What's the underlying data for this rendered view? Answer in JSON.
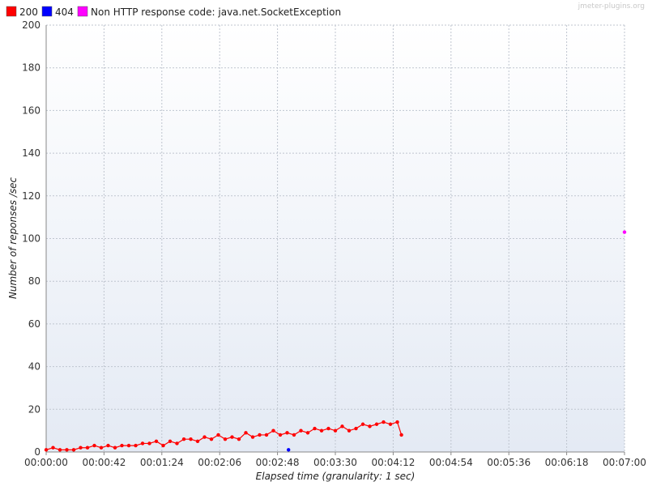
{
  "watermark": "jmeter-plugins.org",
  "colors": {
    "plot_top": "#ffffff",
    "plot_bottom": "#e4eaf4",
    "grid": "#bfc5cf",
    "axis": "#888888"
  },
  "chart_data": {
    "type": "line",
    "title": "",
    "xlabel": "Elapsed time (granularity: 1 sec)",
    "ylabel": "Number of reponses /sec",
    "xlim": [
      0,
      420
    ],
    "ylim": [
      0,
      200
    ],
    "x_ticks": [
      0,
      42,
      84,
      126,
      168,
      210,
      252,
      294,
      336,
      378,
      420
    ],
    "x_tick_labels": [
      "00:00:00",
      "00:00:42",
      "00:01:24",
      "00:02:06",
      "00:02:48",
      "00:03:30",
      "00:04:12",
      "00:04:54",
      "00:05:36",
      "00:06:18",
      "00:07:00"
    ],
    "y_ticks": [
      0,
      20,
      40,
      60,
      80,
      100,
      120,
      140,
      160,
      180,
      200
    ],
    "y_tick_labels": [
      "0",
      "20",
      "40",
      "60",
      "80",
      "100",
      "120",
      "140",
      "160",
      "180",
      "200"
    ],
    "grid": true,
    "legend_position": "top-left",
    "series": [
      {
        "name": "200",
        "color": "#ff0000",
        "x": [
          0,
          5,
          10,
          15,
          20,
          25,
          30,
          35,
          40,
          45,
          50,
          55,
          60,
          65,
          70,
          75,
          80,
          85,
          90,
          95,
          100,
          105,
          110,
          115,
          120,
          125,
          130,
          135,
          140,
          145,
          150,
          155,
          160,
          165,
          170,
          175,
          180,
          185,
          190,
          195,
          200,
          205,
          210,
          215,
          220,
          225,
          230,
          235,
          240,
          245,
          250,
          255,
          258
        ],
        "y": [
          1,
          2,
          1,
          1,
          1,
          2,
          2,
          3,
          2,
          3,
          2,
          3,
          3,
          3,
          4,
          4,
          5,
          3,
          5,
          4,
          6,
          6,
          5,
          7,
          6,
          8,
          6,
          7,
          6,
          9,
          7,
          8,
          8,
          10,
          8,
          9,
          8,
          10,
          9,
          11,
          10,
          11,
          10,
          12,
          10,
          11,
          13,
          12,
          13,
          14,
          13,
          14,
          8
        ]
      },
      {
        "name": "404",
        "color": "#0000ff",
        "x": [
          176
        ],
        "y": [
          1
        ]
      },
      {
        "name": "Non HTTP response code: java.net.SocketException",
        "color": "#ff00ff",
        "x": [
          420
        ],
        "y": [
          103
        ]
      }
    ]
  }
}
